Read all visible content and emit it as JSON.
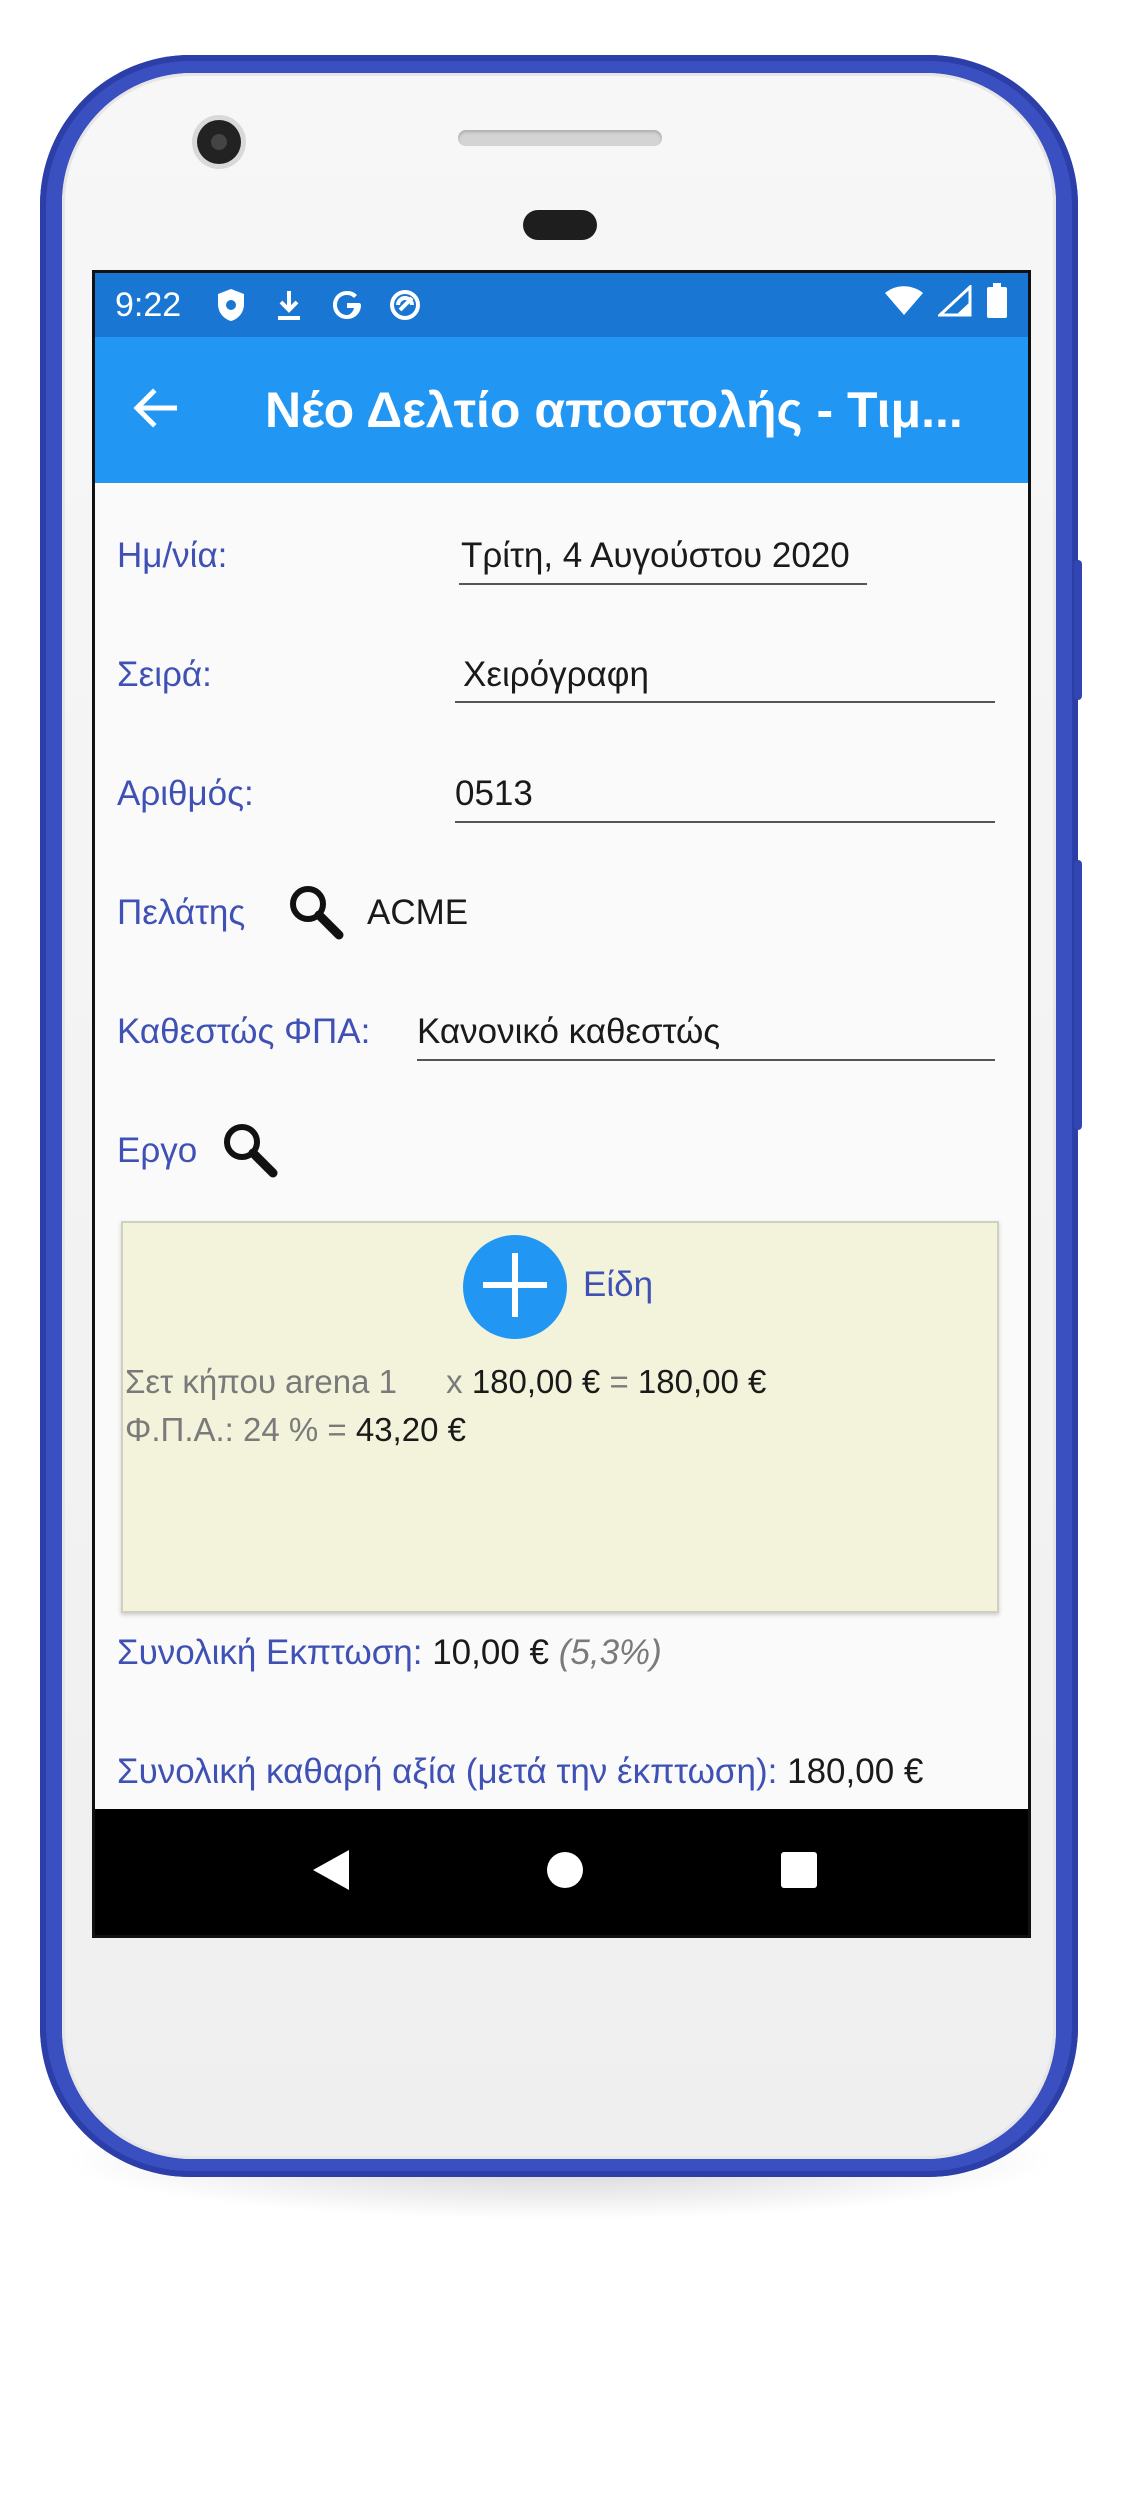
{
  "status_bar": {
    "time": "9:22",
    "icons_left": [
      "shield-icon",
      "download-icon",
      "google-icon",
      "sync-icon"
    ],
    "icons_right": [
      "wifi-icon",
      "signal-icon",
      "battery-icon"
    ]
  },
  "app_bar": {
    "title": "Νέο Δελτίο αποστολής - Τιμ...",
    "back_icon": "arrow-left-icon"
  },
  "form": {
    "date_label": "Ημ/νία:",
    "date_value": "Τρίτη, 4 Αυγούστου 2020",
    "series_label": "Σειρά:",
    "series_value": "Χειρόγραφη",
    "number_label": "Αριθμός:",
    "number_value": "0513",
    "customer_label": "Πελάτης",
    "customer_value": "ACME",
    "vat_status_label": "Καθεστώς ΦΠΑ:",
    "vat_status_value": "Κανονικό καθεστώς",
    "project_label": "Εργο"
  },
  "items": {
    "add_label": "Είδη",
    "lines": [
      {
        "name": "Σετ κήπου arena 1",
        "qty_sep": "x",
        "price": "180,00 €",
        "eq": "=",
        "total": "180,00 €",
        "vat_label": "Φ.Π.Α.: 24 % =",
        "vat_value": "43,20 €"
      }
    ]
  },
  "totals": {
    "discount_label": "Συνολική Εκπτωση:",
    "discount_value": "10,00 €",
    "discount_percent": "(5,3%)",
    "net_label": "Συνολική καθαρή αξία (μετά την έκπτωση):",
    "net_value": "180,00 €"
  },
  "colors": {
    "status_bar": "#1976d2",
    "app_bar": "#2196f3",
    "label": "#3f51b5",
    "card": "#f3f3dc",
    "phone_frame": "#3a4fc0"
  }
}
